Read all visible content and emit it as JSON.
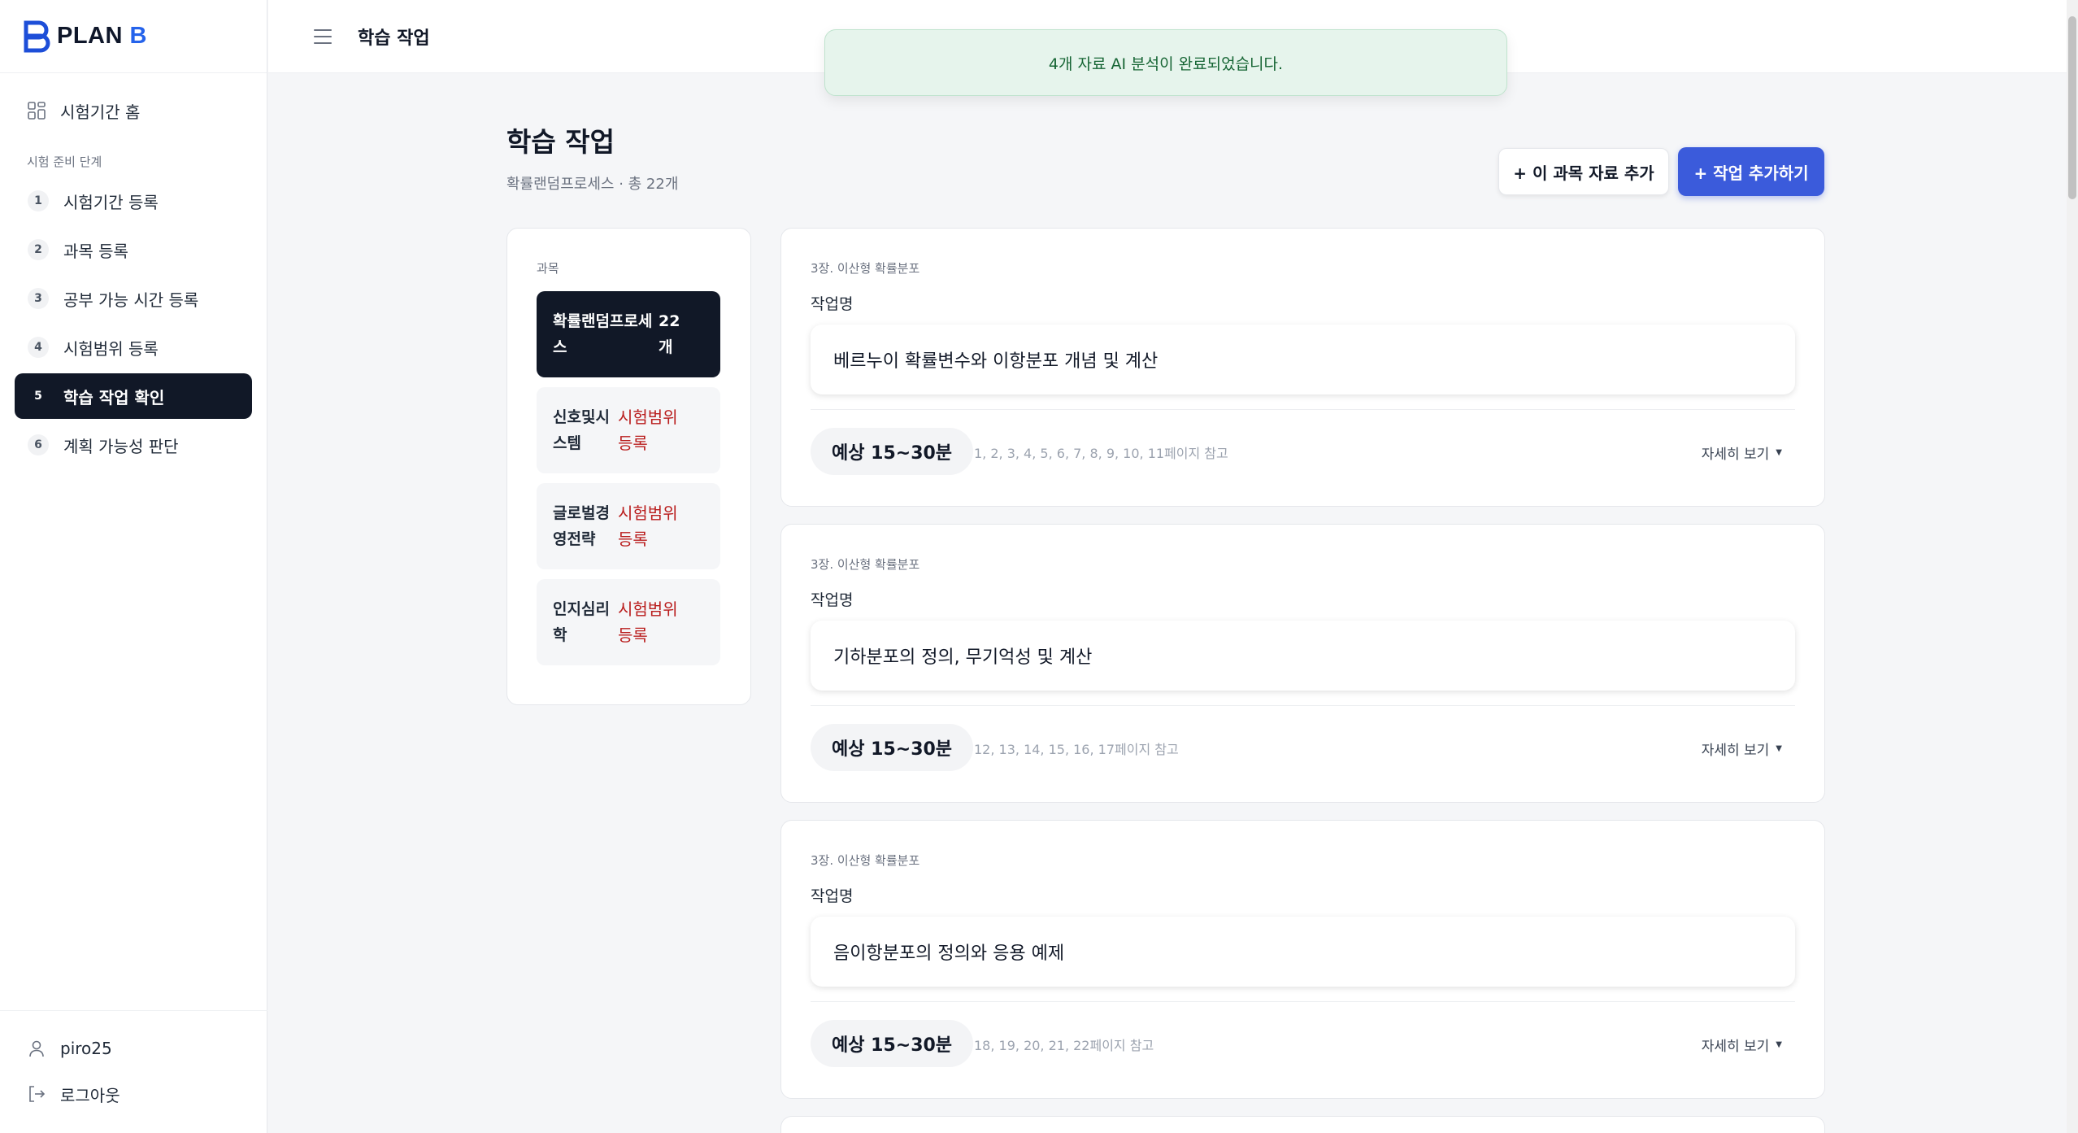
{
  "brand": {
    "name_part1": "PLAN",
    "name_part2": "B"
  },
  "sidebar": {
    "home_label": "시험기간 홈",
    "section_label": "시험 준비 단계",
    "steps": [
      {
        "num": "1",
        "label": "시험기간 등록"
      },
      {
        "num": "2",
        "label": "과목 등록"
      },
      {
        "num": "3",
        "label": "공부 가능 시간 등록"
      },
      {
        "num": "4",
        "label": "시험범위 등록"
      },
      {
        "num": "5",
        "label": "학습 작업 확인"
      },
      {
        "num": "6",
        "label": "계획 가능성 판단"
      }
    ],
    "active_step": 5,
    "user": "piro25",
    "logout": "로그아웃"
  },
  "topbar": {
    "title": "학습 작업"
  },
  "toast": {
    "message": "4개 자료 AI 분석이 완료되었습니다."
  },
  "main": {
    "title": "학습 작업",
    "subtitle": "확률랜덤프로세스 · 총 22개",
    "add_material_button": "+ 이 과목 자료 추가",
    "add_task_button": "+ 작업 추가하기"
  },
  "subjects": {
    "label": "과목",
    "items": [
      {
        "name": "확률랜덤프로세스",
        "count": "22개",
        "active": true
      },
      {
        "name": "신호및시스템",
        "status": "시험범위 등록"
      },
      {
        "name": "글로벌경영전략",
        "status": "시험범위 등록"
      },
      {
        "name": "인지심리학",
        "status": "시험범위 등록"
      }
    ]
  },
  "tasks": [
    {
      "chapter": "3장. 이산형 확률분포",
      "label": "작업명",
      "name": "베르누이 확률변수와 이항분포 개념 및 계산",
      "time": "예상 15~30분",
      "pages": "1, 2, 3, 4, 5, 6, 7, 8, 9, 10, 11페이지 참고",
      "detail": "자세히 보기"
    },
    {
      "chapter": "3장. 이산형 확률분포",
      "label": "작업명",
      "name": "기하분포의 정의, 무기억성 및 계산",
      "time": "예상 15~30분",
      "pages": "12, 13, 14, 15, 16, 17페이지 참고",
      "detail": "자세히 보기"
    },
    {
      "chapter": "3장. 이산형 확률분포",
      "label": "작업명",
      "name": "음이항분포의 정의와 응용 예제",
      "time": "예상 15~30분",
      "pages": "18, 19, 20, 21, 22페이지 참고",
      "detail": "자세히 보기"
    }
  ]
}
